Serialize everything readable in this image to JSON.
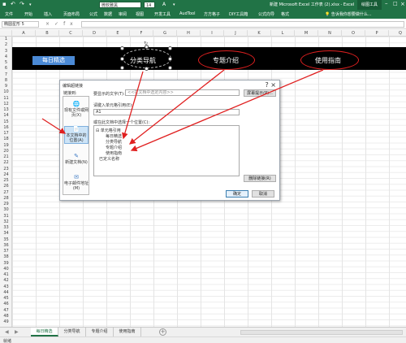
{
  "title_bar": {
    "window_title": "新建 Microsoft Excel 工作表 (2).xlsx - Excel",
    "context_tab": "绘图工具",
    "font_name": "微软雅黑",
    "font_size": "14",
    "font_color_label": "A"
  },
  "ribbon": {
    "tabs": [
      "文件",
      "开始",
      "插入",
      "页面布局",
      "公式",
      "数据",
      "审阅",
      "视图",
      "开发工具",
      "AudTool",
      "方方格子",
      "DIY工具箱",
      "公式向导",
      "格式"
    ],
    "tell_me": "告诉我你想要做什么..."
  },
  "formula_bar": {
    "name_box": "椭圆星形 5",
    "fx": "fx",
    "value": ""
  },
  "grid": {
    "columns": [
      "A",
      "B",
      "C",
      "D",
      "E",
      "F",
      "G",
      "H",
      "I",
      "J",
      "K",
      "L",
      "M",
      "N",
      "O",
      "P",
      "Q"
    ],
    "rows": [
      "1",
      "2",
      "3",
      "4",
      "5",
      "6",
      "7",
      "8",
      "9",
      "10",
      "11",
      "12",
      "13",
      "14",
      "15",
      "16",
      "17",
      "18",
      "19",
      "20",
      "21",
      "22",
      "23",
      "24",
      "25",
      "26",
      "27",
      "28",
      "29",
      "30",
      "31",
      "32",
      "33",
      "34",
      "35",
      "36",
      "37",
      "38",
      "39",
      "40",
      "41",
      "42",
      "43",
      "44",
      "45",
      "46",
      "47",
      "48",
      "49"
    ]
  },
  "banner": {
    "home": "每日精选",
    "nav1": "分类导航",
    "nav2": "专题介绍",
    "nav3": "使用指南"
  },
  "dialog": {
    "title": "编辑超链接",
    "close": "?  ×",
    "link_to_label": "链接到:",
    "display_label": "要显示的文字(T):",
    "display_value": "<<在文档中选定内容>>",
    "screen_tip": "屏幕提示(P)...",
    "cell_ref_label": "请键入单元格引用(E):",
    "cell_ref_value": "A1",
    "place_label": "或在此文档中选择一个位置(C):",
    "link_bar": [
      {
        "icon": "🌐",
        "label": "现有文件或网页(X)"
      },
      {
        "icon": "📄",
        "label": "本文档中的位置(A)"
      },
      {
        "icon": "✎",
        "label": "新建文档(N)"
      },
      {
        "icon": "✉",
        "label": "电子邮件地址(M)"
      }
    ],
    "tree": {
      "root": "单元格引用",
      "children": [
        "每日精选",
        "分类导航",
        "专题介绍",
        "使用指南"
      ],
      "defined_names": "已定义名称"
    },
    "remove_link": "删除链接(R)",
    "ok": "确定",
    "cancel": "取消"
  },
  "sheets": {
    "tabs": [
      "每日精选",
      "分类导航",
      "专题介绍",
      "使用指南"
    ],
    "add": "+"
  },
  "status": {
    "text": "就绪"
  },
  "colors": {
    "excel_green": "#217346",
    "annotation_red": "#e02020",
    "banner_black": "#000000",
    "home_button_blue": "#4b8ad6"
  }
}
